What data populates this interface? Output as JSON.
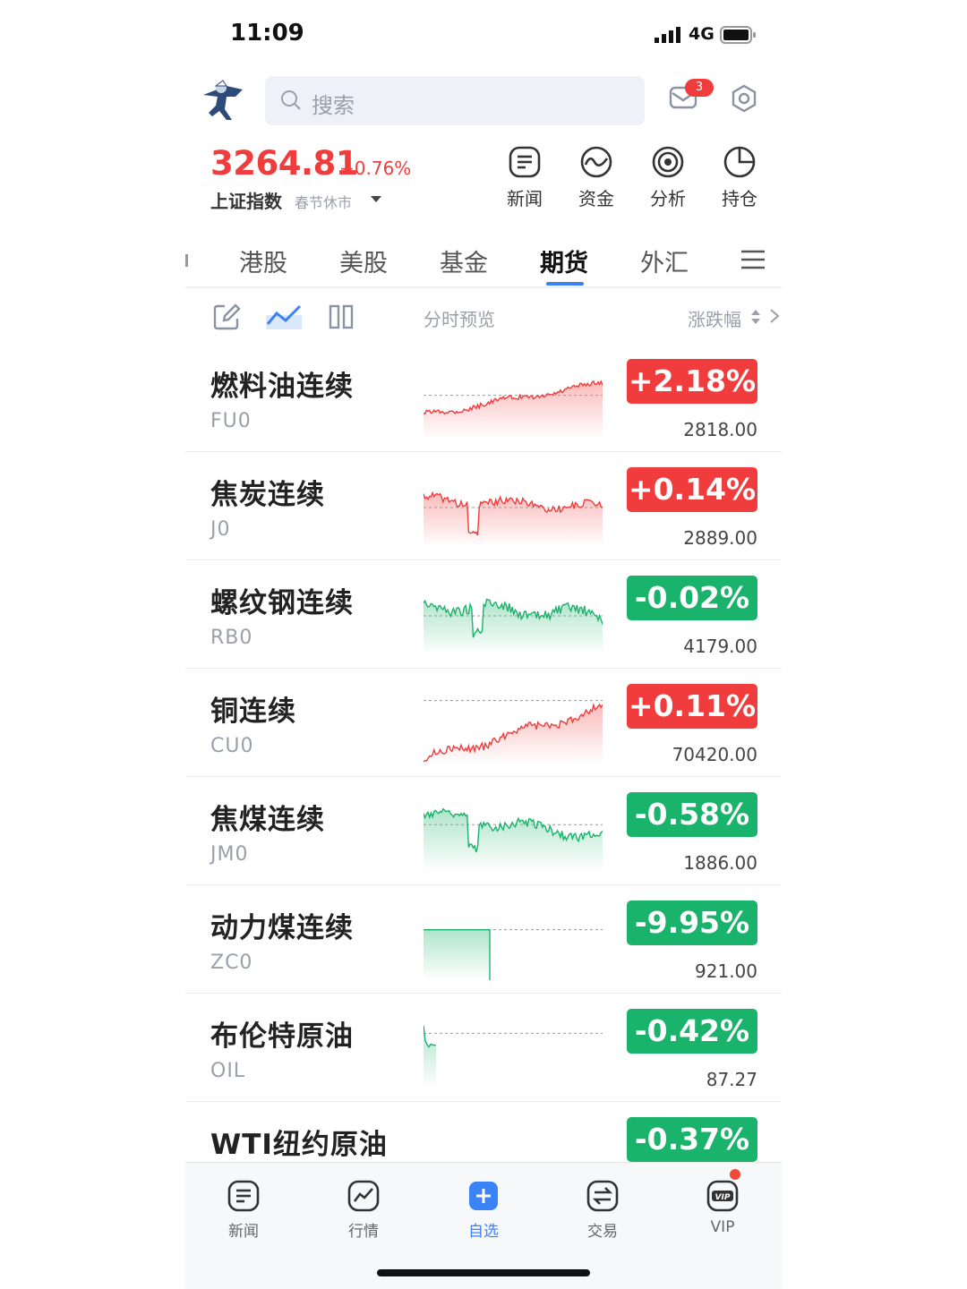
{
  "status": {
    "time": "11:09",
    "network": "4G"
  },
  "header": {
    "search_placeholder": "搜索",
    "mail_badge": "3"
  },
  "index": {
    "value": "3264.81",
    "change_pct": "+0.76%",
    "name": "上证指数",
    "state": "春节休市"
  },
  "quick_actions": [
    {
      "label": "新闻",
      "icon": "news-icon"
    },
    {
      "label": "资金",
      "icon": "capital-flow-icon"
    },
    {
      "label": "分析",
      "icon": "analysis-icon"
    },
    {
      "label": "持仓",
      "icon": "holdings-pie-icon"
    }
  ],
  "market_tabs": [
    "港股",
    "美股",
    "基金",
    "期货",
    "外汇"
  ],
  "active_tab": "期货",
  "toolbar": {
    "preview_label": "分时预览",
    "sort_label": "涨跌幅"
  },
  "colors": {
    "up": "#f03c3c",
    "down": "#1ab36b",
    "accent": "#3b82f6"
  },
  "rows": [
    {
      "name": "燃料油连续",
      "code": "FU0",
      "change": "+2.18%",
      "price": "2818.00",
      "dir": "up"
    },
    {
      "name": "焦炭连续",
      "code": "J0",
      "change": "+0.14%",
      "price": "2889.00",
      "dir": "up"
    },
    {
      "name": "螺纹钢连续",
      "code": "RB0",
      "change": "-0.02%",
      "price": "4179.00",
      "dir": "down"
    },
    {
      "name": "铜连续",
      "code": "CU0",
      "change": "+0.11%",
      "price": "70420.00",
      "dir": "up"
    },
    {
      "name": "焦煤连续",
      "code": "JM0",
      "change": "-0.58%",
      "price": "1886.00",
      "dir": "down"
    },
    {
      "name": "动力煤连续",
      "code": "ZC0",
      "change": "-9.95%",
      "price": "921.00",
      "dir": "down"
    },
    {
      "name": "布伦特原油",
      "code": "OIL",
      "change": "-0.42%",
      "price": "87.27",
      "dir": "down"
    },
    {
      "name": "WTI纽约原油",
      "code": "",
      "change": "-0.37%",
      "price": "",
      "dir": "down"
    }
  ],
  "bottom_nav": [
    {
      "label": "新闻",
      "icon": "news-icon"
    },
    {
      "label": "行情",
      "icon": "market-chart-icon"
    },
    {
      "label": "自选",
      "icon": "watchlist-plus-icon",
      "active": true
    },
    {
      "label": "交易",
      "icon": "trade-exchange-icon"
    },
    {
      "label": "VIP",
      "icon": "vip-icon"
    }
  ]
}
